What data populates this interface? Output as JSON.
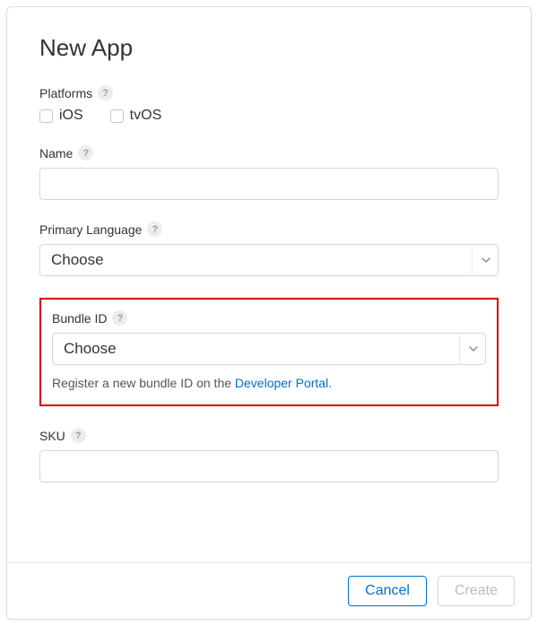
{
  "title": "New App",
  "platforms": {
    "label": "Platforms",
    "options": {
      "ios": "iOS",
      "tvos": "tvOS"
    }
  },
  "name": {
    "label": "Name",
    "value": ""
  },
  "primaryLanguage": {
    "label": "Primary Language",
    "selected": "Choose"
  },
  "bundleId": {
    "label": "Bundle ID",
    "selected": "Choose",
    "helpPrefix": "Register a new bundle ID on the ",
    "helpLink": "Developer Portal",
    "helpSuffix": "."
  },
  "sku": {
    "label": "SKU",
    "value": ""
  },
  "buttons": {
    "cancel": "Cancel",
    "create": "Create"
  },
  "helpGlyph": "?"
}
